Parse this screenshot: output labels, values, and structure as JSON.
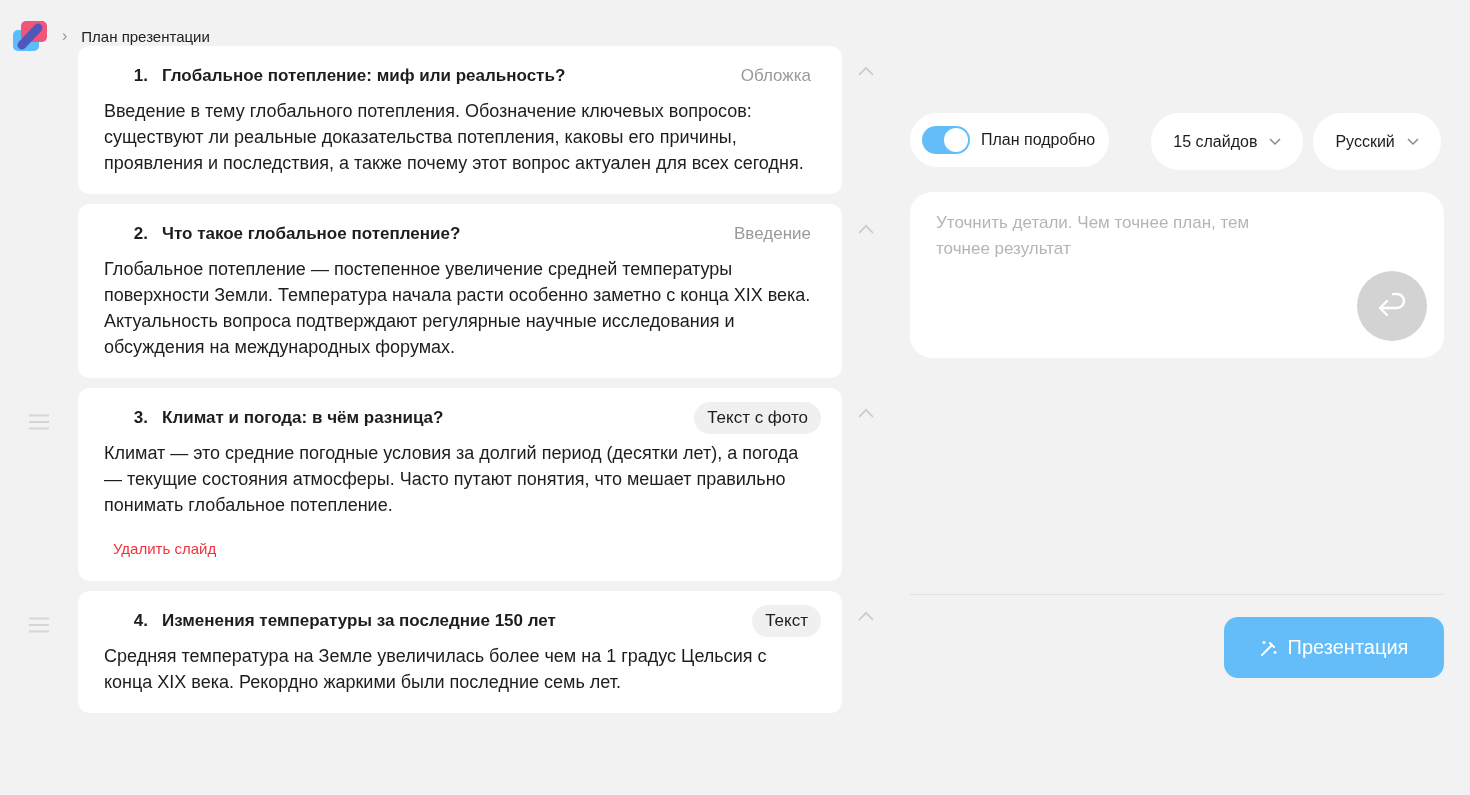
{
  "breadcrumb": {
    "separator": "›",
    "label": "План презентации"
  },
  "slides": [
    {
      "number": "1.",
      "title": "Глобальное потепление: миф или реальность?",
      "layout": "Обложка",
      "highlighted": false,
      "expanded": true,
      "text": "Введение в тему глобального потепления. Обозначение ключевых вопросов: существуют ли реальные доказательства потепления, каковы его причины, проявления и последствия, а также почему этот вопрос актуален для всех сегодня."
    },
    {
      "number": "2.",
      "title": "Что такое глобальное потепление?",
      "layout": "Введение",
      "highlighted": false,
      "expanded": true,
      "text": "Глобальное потепление — постепенное увеличение средней температуры поверхности Земли. Температура начала расти особенно заметно с конца XIX века. Актуальность вопроса подтверждают регулярные научные исследования и обсуждения на международных форумах."
    },
    {
      "number": "3.",
      "title": "Климат и погода: в чём разница?",
      "layout": "Текст с фото",
      "highlighted": true,
      "expanded": true,
      "text": "Климат — это средние погодные условия за долгий период (десятки лет), а погода — текущие состояния атмосферы. Часто путают понятия, что мешает правильно понимать глобальное потепление.",
      "delete_label": "Удалить слайд"
    },
    {
      "number": "4.",
      "title": "Изменения температуры за последние 150 лет",
      "layout": "Текст",
      "highlighted": true,
      "expanded": true,
      "text": "Средняя температура на Земле увеличилась более чем на 1 градус Цельсия с конца XIX века. Рекордно жаркими были последние семь лет."
    }
  ],
  "options": {
    "detailed_toggle": {
      "label": "План подробно",
      "on": true
    },
    "slide_count": "15 слайдов",
    "language": "Русский"
  },
  "details": {
    "placeholder": "Уточнить детали. Чем точнее план, тем точнее результат"
  },
  "generate_button": "Презентация"
}
